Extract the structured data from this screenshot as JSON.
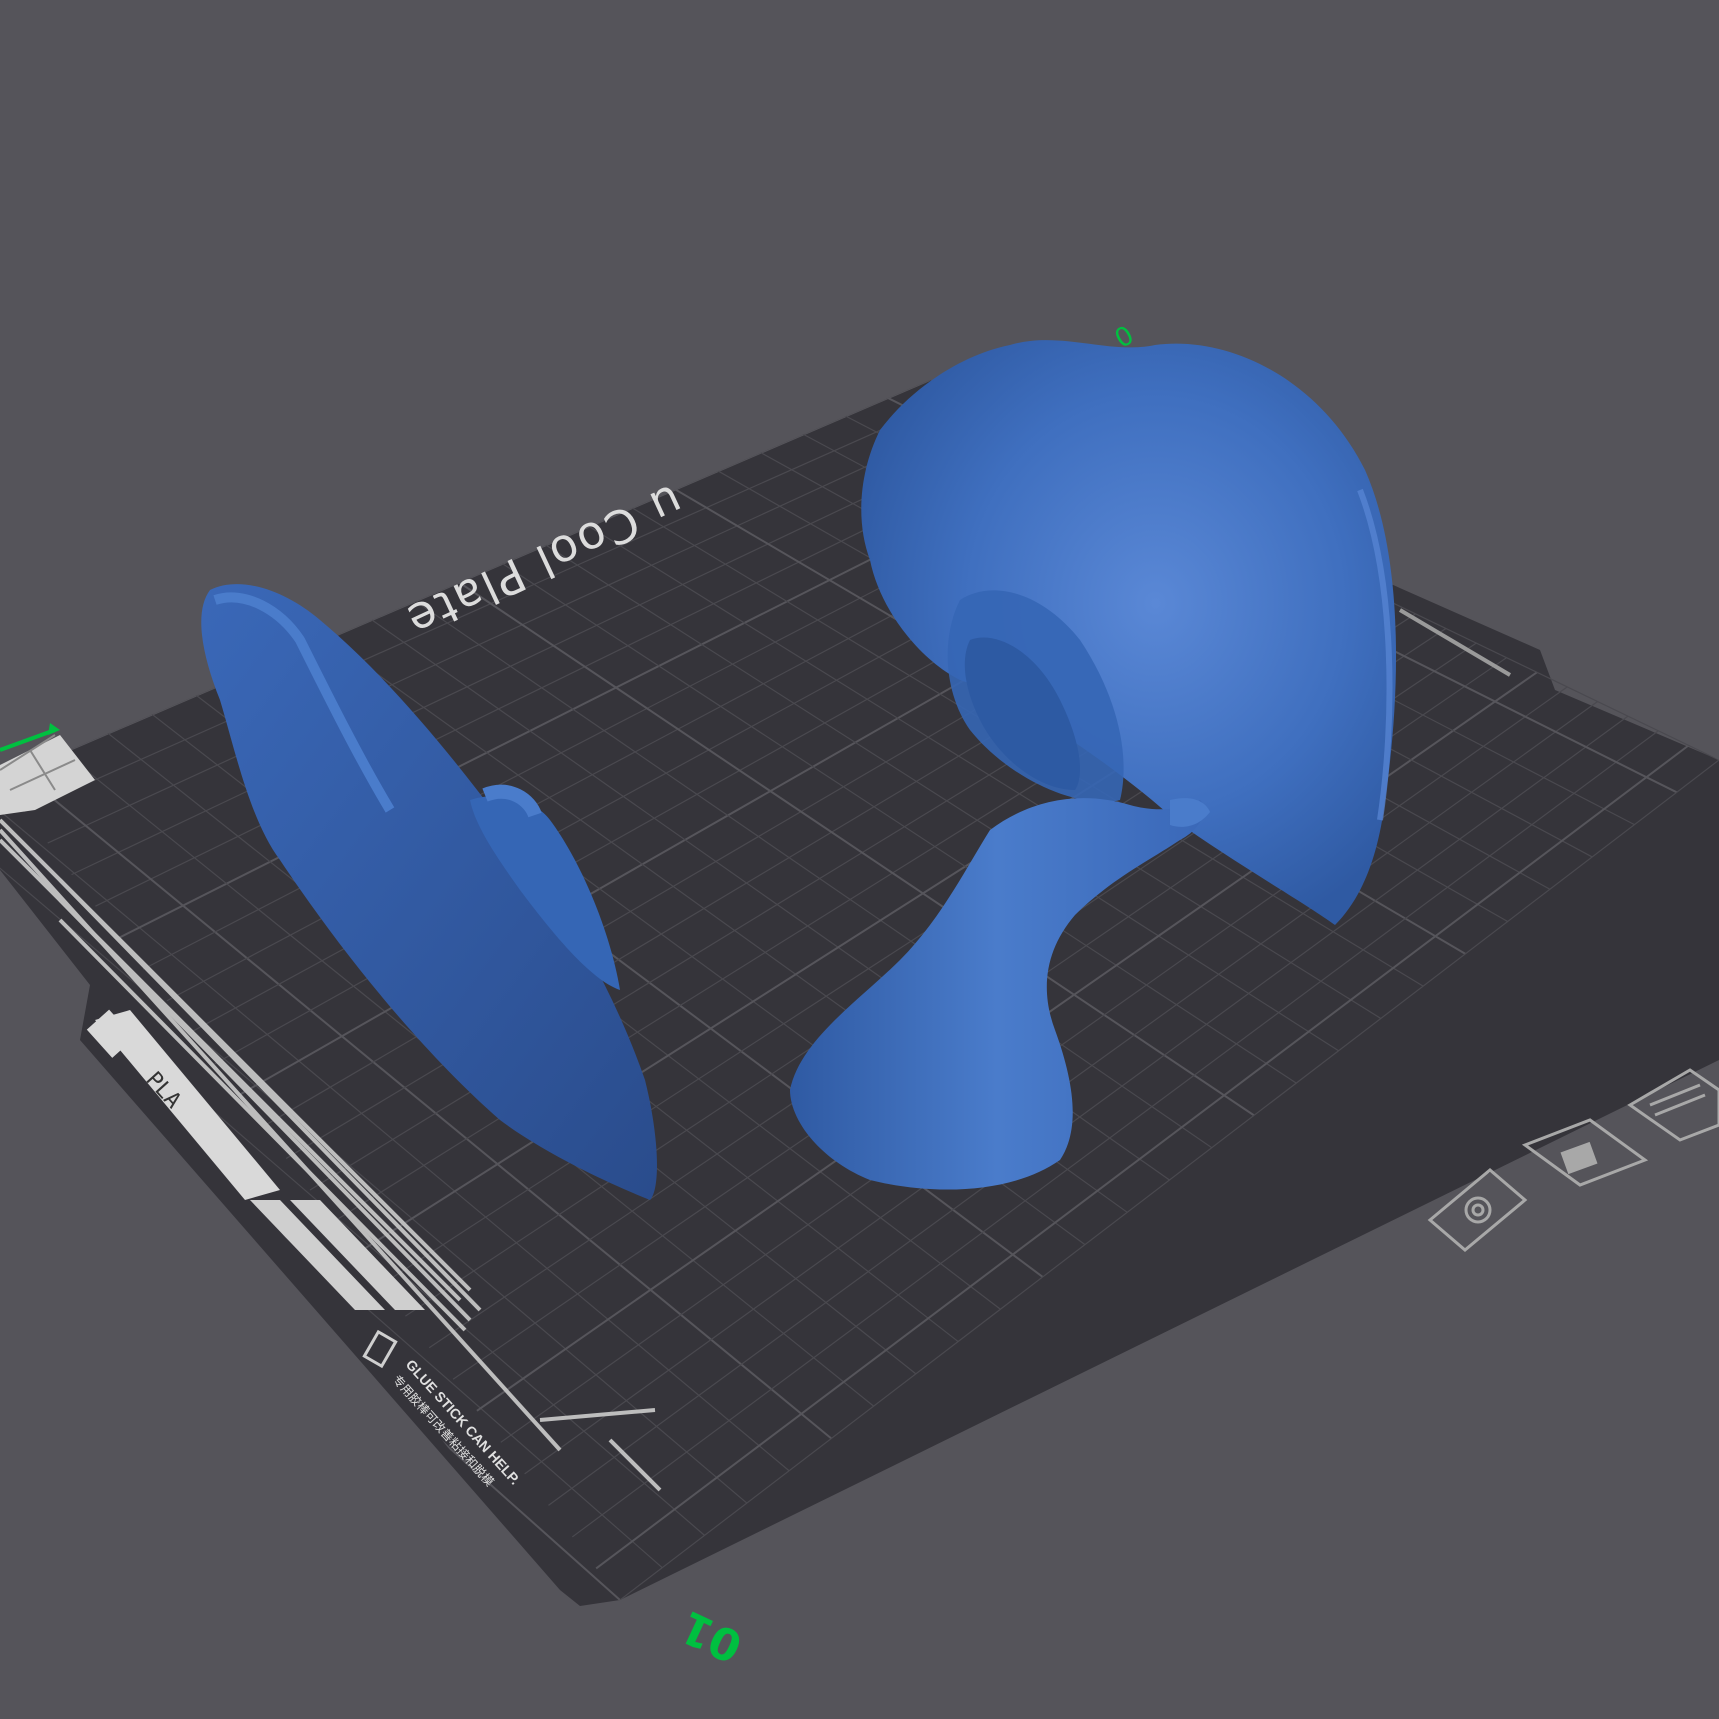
{
  "viewport": {
    "background": "#55545a"
  },
  "plate": {
    "label": "u Cool Plate",
    "label_partial_note_visible": true,
    "number": "01",
    "corner_mark": "0",
    "filament_tag": "PLA",
    "warning_line_1": "GLUE STICK CAN HELP.",
    "warning_line_2": "专用胶棒可改善粘接和脱模",
    "colors": {
      "surface": "#35343a",
      "grid": "#4a494f",
      "grid_major": "#56555b",
      "markings": "#bdbdbd",
      "accent_green": "#00c040"
    }
  },
  "models": {
    "color": "#3f6fbf",
    "color_shadow": "#2d4f8f",
    "color_highlight": "#5a88d6",
    "items": [
      "ear-part-left",
      "ear-part-right",
      "ear-canal-stem"
    ]
  },
  "icons": [
    "axis-origin-icon",
    "hex-nut-icon",
    "lock-icon",
    "layout-icon"
  ]
}
